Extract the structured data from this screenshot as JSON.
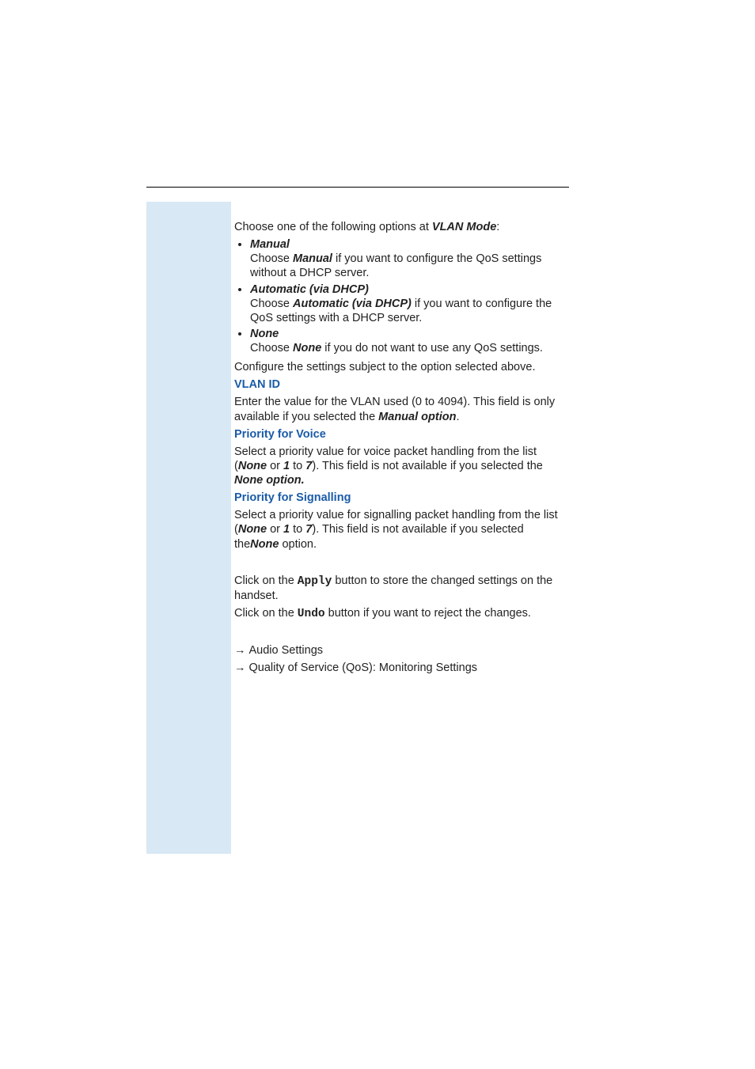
{
  "intro": {
    "lead_pre": "Choose one of the following options at ",
    "lead_bold": "VLAN Mode",
    "lead_post": ":"
  },
  "bullets": {
    "manual_title": "Manual",
    "manual_pre": "Choose ",
    "manual_bold": "Manual",
    "manual_post": " if you want to configure the QoS settings without a DHCP server.",
    "auto_title": "Automatic (via DHCP)",
    "auto_pre": "Choose ",
    "auto_bold": "Automatic (via DHCP)",
    "auto_post": " if you want to configure the QoS settings with a DHCP server.",
    "none_title": "None",
    "none_pre": "Choose ",
    "none_bold": "None",
    "none_post": " if you do not want to use any QoS settings."
  },
  "config_line": "Configure the settings subject to the option selected above.",
  "vlan_id": {
    "heading": "VLAN ID",
    "body_pre": "Enter the value for the VLAN used (0 to 4094). This field is only available if you selected the ",
    "body_bold": "Manual option",
    "body_post": "."
  },
  "voice": {
    "heading": "Priority for Voice",
    "pre": "Select a priority value for voice packet handling from the list (",
    "none": "None",
    "or": " or ",
    "one": "1",
    "to": " to ",
    "seven": "7",
    "mid": "). This field is not available if you selected the ",
    "none_opt": "None option.",
    "post": ""
  },
  "sig": {
    "heading": "Priority for Signalling",
    "pre": "Select a priority value for signalling packet handling from the list (",
    "none": "None",
    "or": " or ",
    "one": "1",
    "to": " to ",
    "seven": "7",
    "mid": "). This field is not available if you selected the",
    "none_opt": "None",
    "post": " option."
  },
  "actions": {
    "apply_pre": "Click on the ",
    "apply": "Apply",
    "apply_post": " button to store the changed settings on the handset.",
    "undo_pre": "Click on the ",
    "undo": "Undo",
    "undo_post": " button if you want to reject the changes."
  },
  "links": {
    "arrow": "→",
    "audio": "Audio Settings",
    "qos": "Quality of Service (QoS): Monitoring Settings"
  }
}
